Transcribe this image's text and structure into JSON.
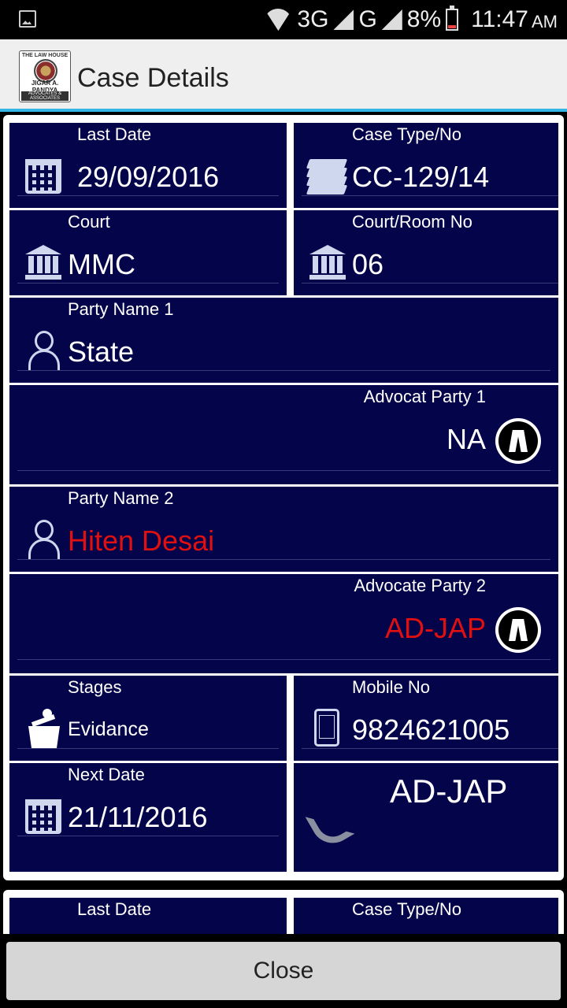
{
  "status_bar": {
    "network": "3G",
    "network2": "G",
    "battery": "8%",
    "time": "11:47",
    "ampm": "AM"
  },
  "app_bar": {
    "title": "Case Details",
    "logo": {
      "top_text": "THE LAW HOUSE",
      "name": "JIGAR A. PANDYA",
      "sub": "ADVOCATES & ASSOCIATES"
    }
  },
  "case1": {
    "last_date_label": "Last Date",
    "last_date": "29/09/2016",
    "case_type_label": "Case Type/No",
    "case_type": "CC-129/14",
    "court_label": "Court",
    "court": "MMC",
    "room_label": "Court/Room No",
    "room": "06",
    "party1_label": "Party Name 1",
    "party1": "State",
    "adv1_label": "Advocat Party 1",
    "adv1": "NA",
    "party2_label": "Party Name 2",
    "party2": "Hiten Desai",
    "adv2_label": "Advocate Party 2",
    "adv2": "AD-JAP",
    "stages_label": "Stages",
    "stages": "Evidance",
    "mobile_label": "Mobile No",
    "mobile": "9824621005",
    "next_date_label": "Next Date",
    "next_date": "21/11/2016",
    "call_name": "AD-JAP"
  },
  "case2": {
    "last_date_label": "Last Date",
    "case_type_label": "Case Type/No"
  },
  "footer": {
    "close_label": "Close"
  },
  "colors": {
    "cell_bg": "#04044a",
    "accent_line": "#33b5e5",
    "highlight_red": "#e01010"
  }
}
